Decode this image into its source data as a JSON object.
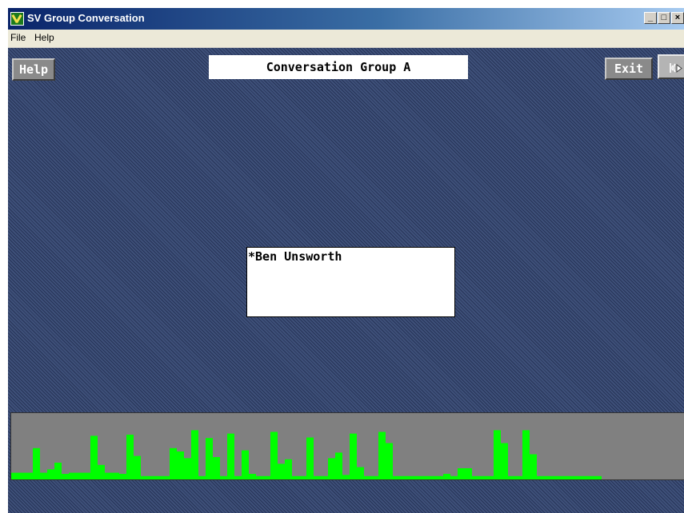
{
  "window": {
    "title": "SV Group Conversation",
    "controls": [
      "_",
      "□",
      "×"
    ]
  },
  "menu": [
    "File",
    "Help"
  ],
  "toolbar": {
    "help_label": "Help",
    "group_title": "Conversation Group A",
    "exit_label": "Exit",
    "speaker_icon": "speaker-icon"
  },
  "members": [
    "*Ben Unsworth"
  ],
  "activity": {
    "colors": {
      "bar": "#00ff00",
      "panel": "#808080",
      "background": "#3e5079"
    },
    "levels": [
      0.12,
      0.12,
      0.12,
      0.56,
      0.12,
      0.18,
      0.3,
      0.1,
      0.12,
      0.12,
      0.12,
      0.78,
      0.26,
      0.12,
      0.12,
      0.1,
      0.8,
      0.42,
      0.06,
      0.06,
      0.06,
      0.06,
      0.56,
      0.5,
      0.38,
      0.88,
      0.06,
      0.74,
      0.4,
      0.06,
      0.82,
      0.06,
      0.52,
      0.1,
      0.06,
      0.06,
      0.85,
      0.28,
      0.36,
      0.06,
      0.06,
      0.75,
      0.06,
      0.06,
      0.38,
      0.48,
      0.08,
      0.82,
      0.22,
      0.06,
      0.06,
      0.85,
      0.65,
      0.06,
      0.06,
      0.06,
      0.06,
      0.06,
      0.06,
      0.06,
      0.1,
      0.06,
      0.2,
      0.2,
      0.06,
      0.06,
      0.06,
      0.88,
      0.65,
      0.06,
      0.06,
      0.88,
      0.45,
      0.06,
      0.06,
      0.06,
      0.06,
      0.06,
      0.06,
      0.06,
      0.06,
      0.06
    ]
  }
}
